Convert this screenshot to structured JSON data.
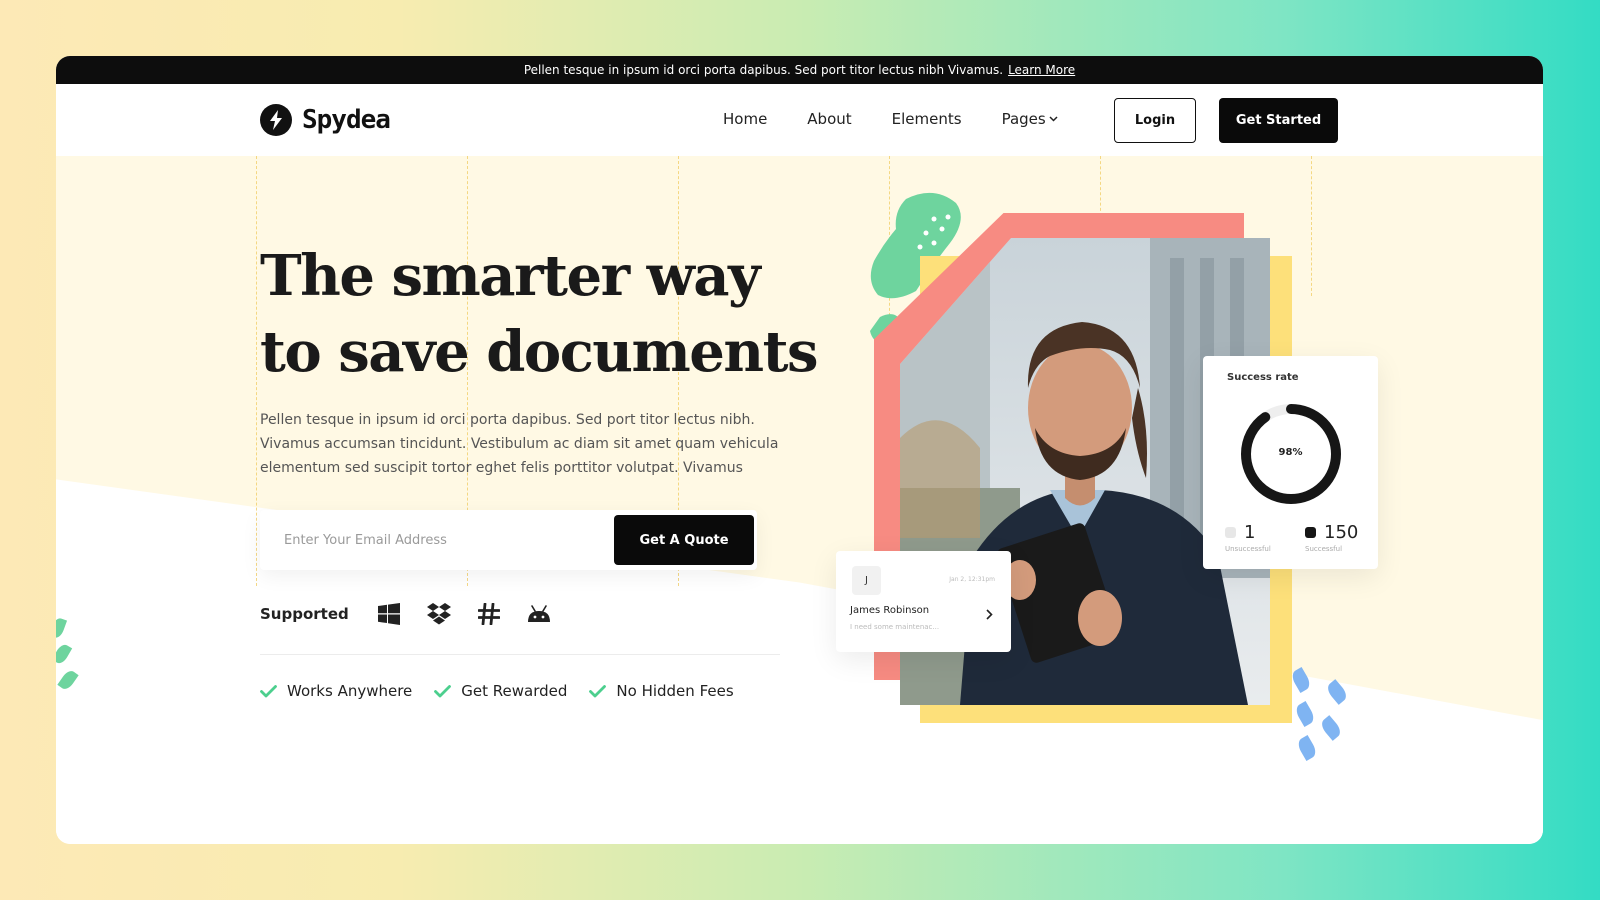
{
  "announcement": {
    "text": "Pellen tesque in ipsum id orci porta dapibus. Sed port titor lectus nibh Vivamus.",
    "link": "Learn More"
  },
  "brand": {
    "name": "Spydea"
  },
  "nav": {
    "items": [
      "Home",
      "About",
      "Elements",
      "Pages"
    ],
    "login": "Login",
    "get_started": "Get Started"
  },
  "hero": {
    "headline_line1": "The smarter way",
    "headline_line2": "to save documents",
    "subtext": "Pellen tesque in ipsum id orci porta dapibus. Sed port titor lectus nibh. Vivamus accumsan tincidunt. Vestibulum ac diam sit amet quam vehicula elementum sed suscipit tortor eghet felis porttitor volutpat. Vivamus",
    "email_placeholder": "Enter Your Email Address",
    "cta": "Get A Quote",
    "supported_label": "Supported",
    "supported_icons": [
      "windows-icon",
      "dropbox-icon",
      "slack-icon",
      "android-icon"
    ],
    "features": [
      "Works Anywhere",
      "Get Rewarded",
      "No Hidden Fees"
    ]
  },
  "success_card": {
    "title": "Success rate",
    "rate": "98%",
    "rate_value": 0.98,
    "unsuccessful_count": "1",
    "unsuccessful_label": "Unsuccessful",
    "successful_count": "150",
    "successful_label": "Successful"
  },
  "message_card": {
    "avatar_initial": "J",
    "time": "Jan 2, 12:31pm",
    "name": "James Robinson",
    "preview": "I need some maintenac..."
  },
  "colors": {
    "accent_green": "#4ccf8e",
    "coral": "#f78b82",
    "yellow": "#fde07a",
    "blob_green": "#6ed49e",
    "leaf_blue": "#7fb4f2",
    "dark": "#0a0a0a"
  }
}
